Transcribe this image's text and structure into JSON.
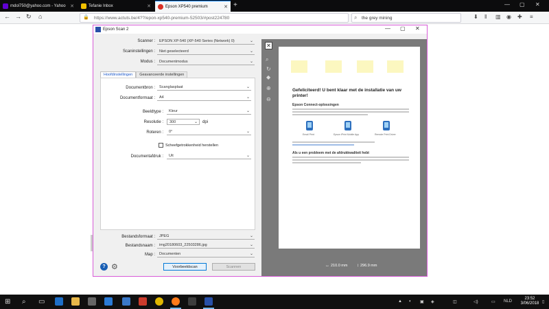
{
  "browser": {
    "tabs": [
      {
        "label": "mdol750@yahoo.com - Yahoo",
        "color": "#6001d2",
        "active": false
      },
      {
        "label": "Tefanie Inbox",
        "color": "#f0c000",
        "active": false
      },
      {
        "label": "Epson XP540 premium",
        "color": "#d93025",
        "active": true
      }
    ],
    "url": "https://www.actuts.be/4??/epon-xp540-premium-52503/#post224780",
    "search_text": "the grey mining",
    "window_controls": {
      "minimize": "—",
      "maximize": "▢",
      "close": "✕"
    }
  },
  "scan": {
    "window_title": "Epson Scan 2",
    "scanner_label": "Scanner :",
    "scanner_value": "EPSON XP-540 (XP-540 Series (Network) 0)",
    "settings_label": "Scaninstellingen :",
    "settings_value": "Niet geselecteerd",
    "mode_label": "Modus :",
    "mode_value": "Documentmodus",
    "tab_main": "Hoofdinstellingen",
    "tab_advanced": "Geavanceerde instellingen",
    "document_source_label": "Documentbron :",
    "document_source_value": "Scanglasplaat",
    "document_size_label": "Documentformaat :",
    "document_size_value": "A4",
    "image_type_label": "Beeldtype :",
    "image_type_value": "Kleur",
    "resolution_label": "Resolutie :",
    "resolution_value": "300",
    "resolution_unit": "dpi",
    "rotate_label": "Roteren :",
    "rotate_value": "0°",
    "checkbox_label": "Scheefgetrokkenheid herstellen",
    "enhancement_label": "Documentafdruk :",
    "enhancement_value": "Uit",
    "format_label": "Bestandsformaat :",
    "format_value": "JPEG",
    "filename_label": "Bestandsnaam :",
    "filename_value": "img20180603_22503286.jpg",
    "folder_label": "Map :",
    "folder_value": "Documenten",
    "preview_button": "Voorbeeldscan",
    "scan_button": "Scannen"
  },
  "preview": {
    "heading": "Gefeliciteerd! U bent klaar met de installatie van uw printer!",
    "section1": "Epson Connect-oplossingen",
    "section2": "Als u een probleem met de afdrukkwaliteit hebt",
    "apps": [
      "Email Print",
      "Epson iPrint Mobile App",
      "Remote Print Driver"
    ],
    "size_w": "210.0 mm",
    "size_h": "296.9 mm"
  },
  "taskbar": {
    "time": "23:52",
    "date": "3/06/2018",
    "lang": "NLD"
  }
}
